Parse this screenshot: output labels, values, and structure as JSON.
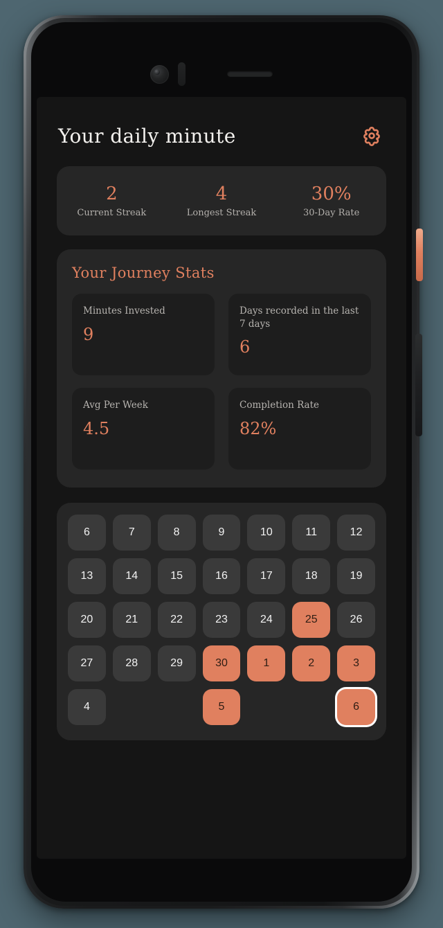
{
  "header": {
    "title": "Your daily minute",
    "settings_icon": "gear-icon"
  },
  "summary": {
    "items": [
      {
        "value": "2",
        "label": "Current Streak"
      },
      {
        "value": "4",
        "label": "Longest Streak"
      },
      {
        "value": "30%",
        "label": "30-Day Rate"
      }
    ]
  },
  "journey": {
    "title": "Your Journey Stats",
    "cards": [
      {
        "label": "Minutes Invested",
        "value": "9"
      },
      {
        "label": "Days recorded in the last 7 days",
        "value": "6"
      },
      {
        "label": "Avg Per Week",
        "value": "4.5"
      },
      {
        "label": "Completion Rate",
        "value": "82%"
      }
    ]
  },
  "calendar": {
    "days": [
      {
        "label": "6",
        "state": "inactive"
      },
      {
        "label": "7",
        "state": "inactive"
      },
      {
        "label": "8",
        "state": "inactive"
      },
      {
        "label": "9",
        "state": "inactive"
      },
      {
        "label": "10",
        "state": "inactive"
      },
      {
        "label": "11",
        "state": "inactive"
      },
      {
        "label": "12",
        "state": "inactive"
      },
      {
        "label": "13",
        "state": "inactive"
      },
      {
        "label": "14",
        "state": "inactive"
      },
      {
        "label": "15",
        "state": "inactive"
      },
      {
        "label": "16",
        "state": "inactive"
      },
      {
        "label": "17",
        "state": "inactive"
      },
      {
        "label": "18",
        "state": "inactive"
      },
      {
        "label": "19",
        "state": "inactive"
      },
      {
        "label": "20",
        "state": "inactive"
      },
      {
        "label": "21",
        "state": "inactive"
      },
      {
        "label": "22",
        "state": "inactive"
      },
      {
        "label": "23",
        "state": "inactive"
      },
      {
        "label": "24",
        "state": "inactive"
      },
      {
        "label": "25",
        "state": "active"
      },
      {
        "label": "26",
        "state": "inactive"
      },
      {
        "label": "27",
        "state": "inactive"
      },
      {
        "label": "28",
        "state": "inactive"
      },
      {
        "label": "29",
        "state": "inactive"
      },
      {
        "label": "30",
        "state": "active"
      },
      {
        "label": "1",
        "state": "active"
      },
      {
        "label": "2",
        "state": "active"
      },
      {
        "label": "3",
        "state": "active"
      },
      {
        "label": "4",
        "state": "inactive"
      },
      {
        "label": "",
        "state": "empty"
      },
      {
        "label": "",
        "state": "empty"
      },
      {
        "label": "5",
        "state": "active"
      },
      {
        "label": "",
        "state": "empty"
      },
      {
        "label": "",
        "state": "empty"
      },
      {
        "label": "6",
        "state": "today"
      }
    ]
  },
  "colors": {
    "accent": "#e0805f",
    "screen_background": "#151515",
    "card_background": "#262626",
    "inner_card_background": "#1d1d1d",
    "cell_inactive": "#3a3a3a",
    "page_background": "#4e6670",
    "today_ring": "#ffffff"
  },
  "device": {
    "power_button_color": "#e0805f",
    "front_camera": "camera-icon",
    "speaker": "speaker-grille-icon"
  }
}
